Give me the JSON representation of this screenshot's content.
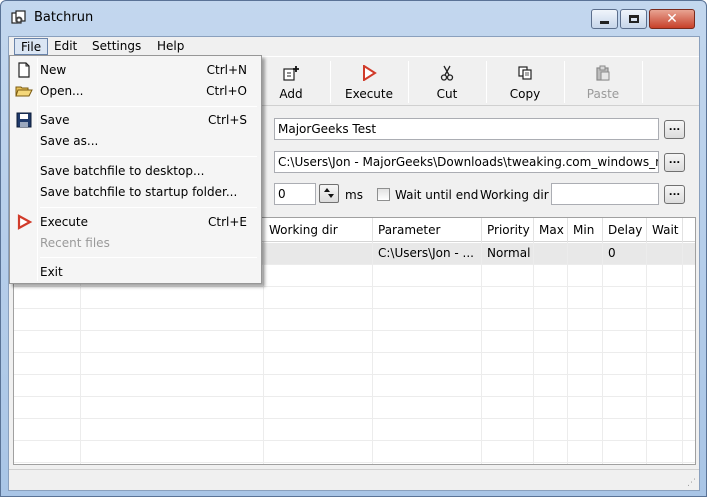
{
  "window": {
    "title": "Batchrun",
    "controls": {
      "minimize": "minimize",
      "maximize": "maximize",
      "close": "✕"
    }
  },
  "menubar": {
    "items": [
      {
        "label": "File",
        "active": true
      },
      {
        "label": "Edit"
      },
      {
        "label": "Settings"
      },
      {
        "label": "Help"
      }
    ]
  },
  "toolbar": {
    "buttons": [
      {
        "label": "Add",
        "icon": "add-icon",
        "enabled": true
      },
      {
        "label": "Execute",
        "icon": "execute-icon",
        "enabled": true
      },
      {
        "label": "Cut",
        "icon": "scissors-icon",
        "enabled": true
      },
      {
        "label": "Copy",
        "icon": "copy-icon",
        "enabled": true
      },
      {
        "label": "Paste",
        "icon": "paste-icon",
        "enabled": false
      }
    ]
  },
  "form": {
    "description_value": "MajorGeeks Test",
    "file_path_value": "C:\\Users\\Jon - MajorGeeks\\Downloads\\tweaking.com_windows_repair_",
    "delay_value": "0",
    "delay_unit": "ms",
    "wait_until_end_label": "Wait until end",
    "wait_until_end_checked": false,
    "working_dir_label": "Working dir",
    "working_dir_value": "",
    "browse_label": "..."
  },
  "grid": {
    "columns": [
      "Working dir",
      "Parameter",
      "Priority",
      "Max",
      "Min",
      "Delay",
      "Wait"
    ],
    "rows": [
      {
        "working_dir": "",
        "parameter": "C:\\Users\\Jon - ...",
        "priority": "Normal",
        "max": "",
        "min": "",
        "delay": "0",
        "wait": ""
      }
    ]
  },
  "file_menu": {
    "items": [
      {
        "label": "New",
        "shortcut": "Ctrl+N",
        "icon": "new-file-icon",
        "enabled": true
      },
      {
        "label": "Open...",
        "shortcut": "Ctrl+O",
        "icon": "open-folder-icon",
        "enabled": true
      },
      {
        "label": "Save",
        "shortcut": "Ctrl+S",
        "icon": "save-icon",
        "enabled": true
      },
      {
        "label": "Save as...",
        "shortcut": "",
        "enabled": true
      },
      {
        "label": "Save batchfile to desktop...",
        "shortcut": "",
        "enabled": true
      },
      {
        "label": "Save batchfile to startup folder...",
        "shortcut": "",
        "enabled": true
      },
      {
        "label": "Execute",
        "shortcut": "Ctrl+E",
        "icon": "execute-icon",
        "enabled": true
      },
      {
        "label": "Recent files",
        "shortcut": "",
        "enabled": false
      },
      {
        "label": "Exit",
        "shortcut": "",
        "enabled": true
      }
    ]
  },
  "colors": {
    "title_gradient_top": "#c3d7ee",
    "execute_red": "#d13b2a",
    "disabled_text": "#9a9a9a"
  }
}
